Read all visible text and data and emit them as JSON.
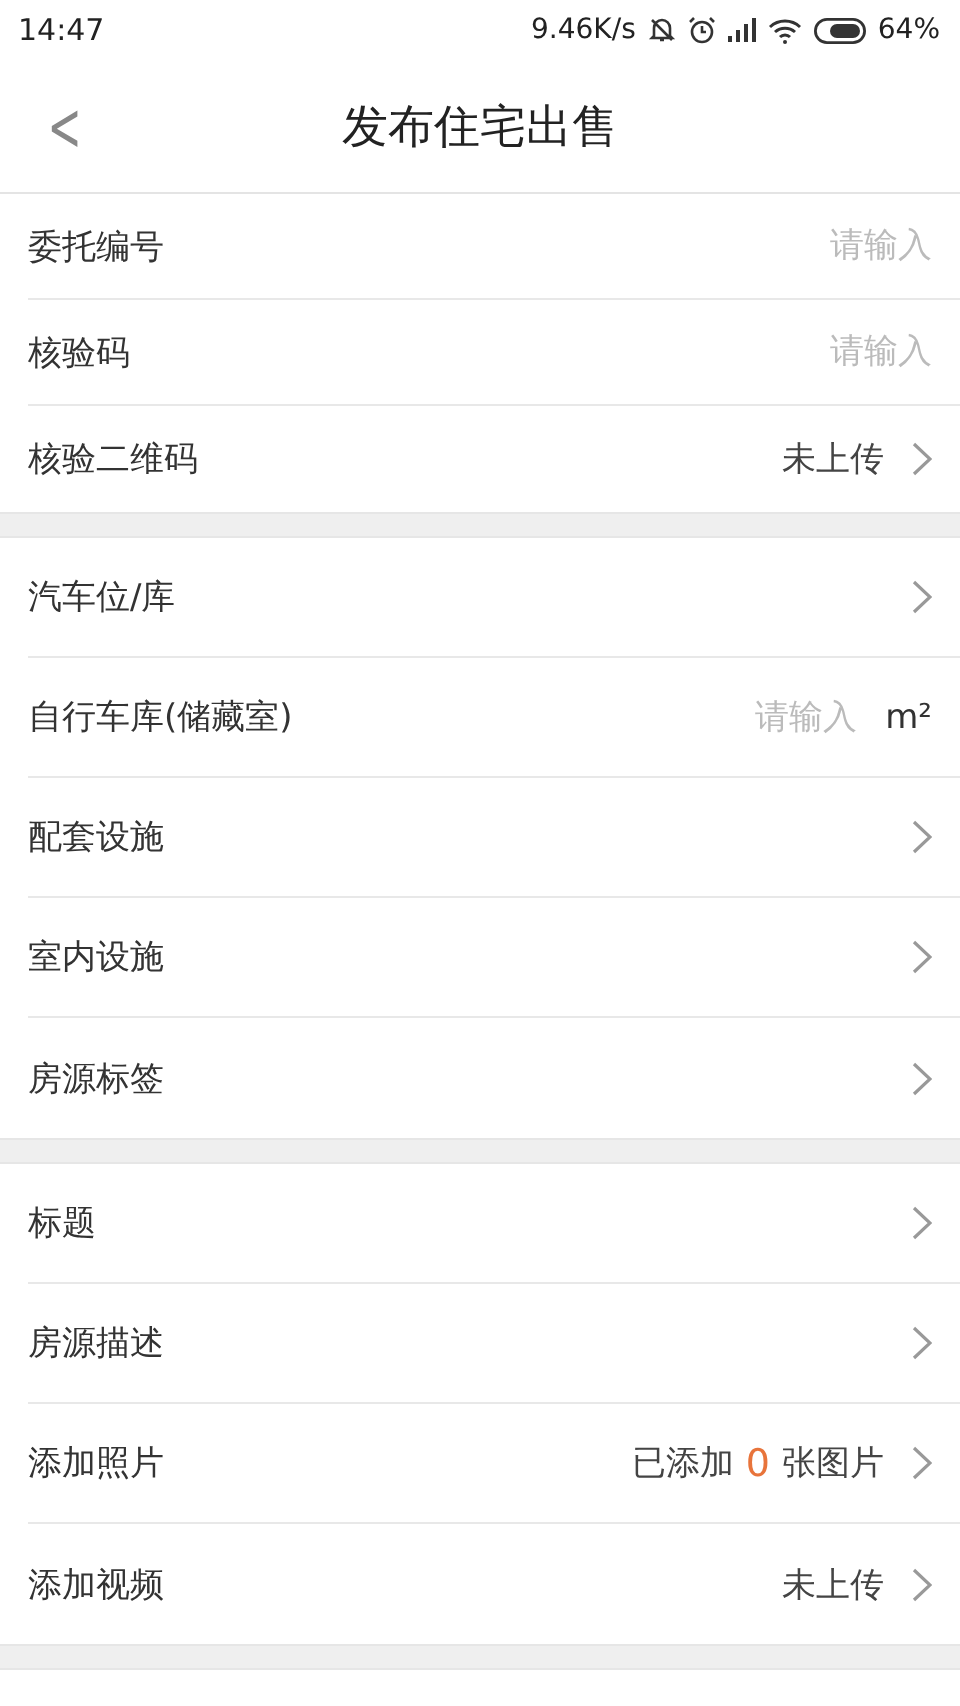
{
  "status_bar": {
    "time": "14:47",
    "speed": "9.46K/s",
    "battery": "64%"
  },
  "header": {
    "back": "<",
    "title": "发布住宅出售"
  },
  "sections": [
    {
      "compact": true,
      "rows": [
        {
          "kind": "input",
          "label": "委托编号",
          "placeholder": "请输入"
        },
        {
          "kind": "input",
          "label": "核验码",
          "placeholder": "请输入"
        },
        {
          "kind": "link",
          "label": "核验二维码",
          "value": "未上传"
        }
      ]
    },
    {
      "compact": false,
      "rows": [
        {
          "kind": "link",
          "label": "汽车位/库"
        },
        {
          "kind": "input",
          "label": "自行车库(储藏室)",
          "placeholder": "请输入",
          "unit": "m²"
        },
        {
          "kind": "link",
          "label": "配套设施"
        },
        {
          "kind": "link",
          "label": "室内设施"
        },
        {
          "kind": "link",
          "label": "房源标签"
        }
      ]
    },
    {
      "compact": false,
      "rows": [
        {
          "kind": "link",
          "label": "标题"
        },
        {
          "kind": "link",
          "label": "房源描述"
        },
        {
          "kind": "photos",
          "label": "添加照片",
          "value_prefix": "已添加",
          "count": "0",
          "value_suffix": "张图片"
        },
        {
          "kind": "link",
          "label": "添加视频",
          "value": "未上传"
        }
      ]
    }
  ]
}
